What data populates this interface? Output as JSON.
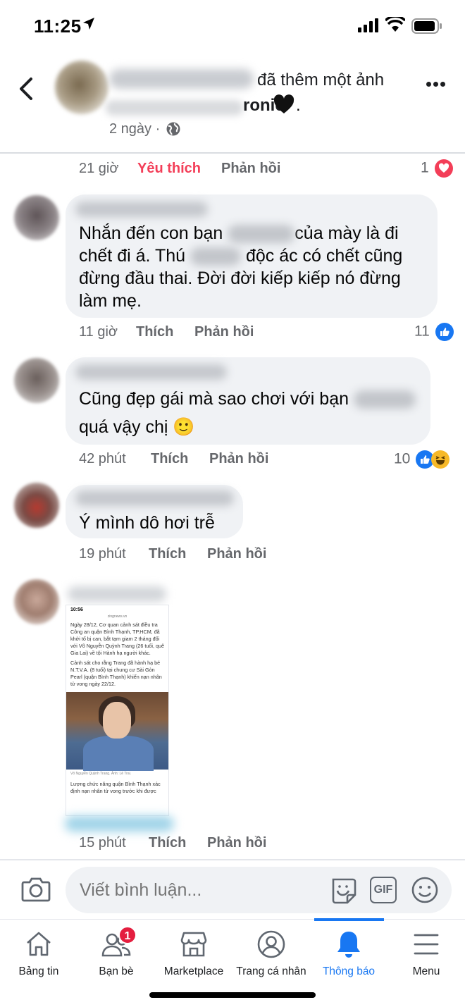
{
  "status_bar": {
    "time": "11:25"
  },
  "header": {
    "action_text": "đã thêm một ảnh",
    "album_text": "ronie",
    "album_suffix": ".",
    "timestamp": "2 ngày",
    "separator": "·"
  },
  "first_comment_actions": {
    "time": "21 giờ",
    "like": "Yêu thích",
    "reply": "Phản hồi",
    "reaction_count": "1"
  },
  "comments": [
    {
      "parts": [
        "Nhắn đến con bạn",
        "của mày là đi",
        "chết đi á. Thú",
        "độc ác có chết cũng",
        "đừng đầu thai. Đời đời kiếp kiếp nó đừng",
        "làm mẹ."
      ],
      "time": "11 giờ",
      "like": "Thích",
      "reply": "Phản hồi",
      "reaction_count": "11"
    },
    {
      "parts": [
        "Cũng đẹp gái mà sao chơi với bạn",
        "quá vậy chị 🙂"
      ],
      "time": "42 phút",
      "like": "Thích",
      "reply": "Phản hồi",
      "reaction_count": "10"
    },
    {
      "parts": [
        "Ý mình dô hơi trễ"
      ],
      "time": "19 phút",
      "like": "Thích",
      "reply": "Phản hồi"
    },
    {
      "attachment": {
        "status_time": "10:56",
        "url": "zingnews.vn",
        "paragraph1": "Ngày 28/12, Cơ quan cảnh sát điều tra Công an quận Bình Thạnh, TP.HCM, đã khởi tố bị can, bắt tạm giam 2 tháng đối với Võ Nguyễn Quỳnh Trang (26 tuổi, quê Gia Lai) về tội Hành hạ người khác.",
        "paragraph2": "Cảnh sát cho rằng Trang đã hành hạ bé N.T.V.A. (8 tuổi) tại chung cư Sài Gòn Pearl (quận Bình Thạnh) khiến nạn nhân tử vong ngày 22/12.",
        "caption": "Võ Nguyễn Quỳnh Trang. Ảnh: Lê Trai.",
        "paragraph3": "Lượng chức năng quận Bình Thạnh xác định nạn nhân tử vong trước khi được"
      },
      "time": "15 phút",
      "like": "Thích",
      "reply": "Phản hồi"
    }
  ],
  "composer": {
    "placeholder": "Viết bình luận...",
    "gif_label": "GIF"
  },
  "tabs": [
    {
      "label": "Bảng tin",
      "icon": "home-icon"
    },
    {
      "label": "Bạn bè",
      "icon": "friends-icon",
      "badge": "1"
    },
    {
      "label": "Marketplace",
      "icon": "marketplace-icon"
    },
    {
      "label": "Trang cá nhân",
      "icon": "profile-icon"
    },
    {
      "label": "Thông báo",
      "icon": "bell-icon",
      "active": true
    },
    {
      "label": "Menu",
      "icon": "menu-icon"
    }
  ],
  "colors": {
    "accent": "#1877f2",
    "like_red": "#f33e58",
    "badge_red": "#e41e3f",
    "bubble": "#f0f2f5",
    "muted": "#65676b"
  }
}
